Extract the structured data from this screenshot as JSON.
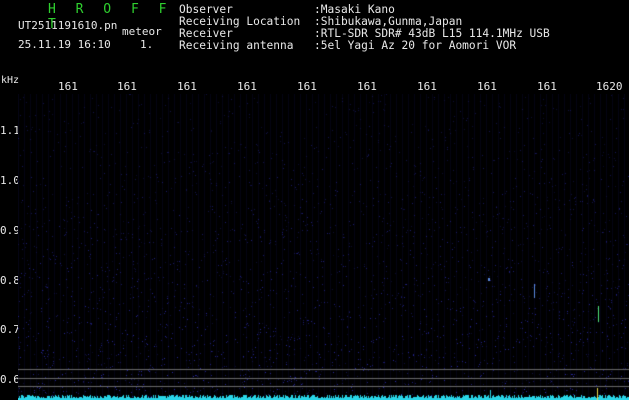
{
  "header": {
    "title": "H R O F F T",
    "filename": "UT2511191610.pn",
    "mode": "meteor",
    "datetime": "25.11.19 16:10",
    "count": "1."
  },
  "meta": [
    {
      "label": "Observer",
      "value": ":Masaki Kano"
    },
    {
      "label": "Receiving Location",
      "value": ":Shibukawa,Gunma,Japan"
    },
    {
      "label": "Receiver",
      "value": ":RTL-SDR SDR# 43dB L15 114.1MHz USB"
    },
    {
      "label": "Receiving antenna",
      "value": ":5el Yagi Az 20 for Aomori VOR"
    }
  ],
  "axes": {
    "unit": "kHz",
    "x_ticks": [
      "161",
      "161",
      "161",
      "161",
      "161",
      "161",
      "161",
      "161",
      "161",
      "1620"
    ],
    "y_ticks": [
      "1.1",
      "1.0",
      "0.9",
      "0.8",
      "0.7",
      "0.6"
    ]
  },
  "colors": {
    "text": "#e8e8e8",
    "title": "#2fd02f",
    "noise": "#1a1a8a",
    "grid": "#6a6a6a",
    "trace": "#29d6e8",
    "meteor_trace": "#4fe37a"
  }
}
